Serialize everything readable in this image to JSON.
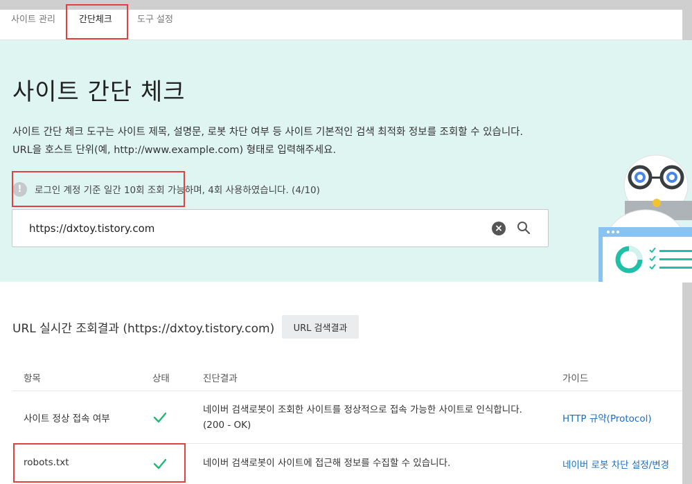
{
  "tabs": [
    "사이트 관리",
    "간단체크",
    "도구 설정"
  ],
  "hero": {
    "title": "사이트 간단 체크",
    "desc_line1": "사이트 간단 체크 도구는 사이트 제목, 설명문, 로봇 차단 여부 등 사이트 기본적인 검색 최적화 정보를 조회할 수 있습니다.",
    "desc_line2": "URL을 호스트 단위(예, http://www.example.com) 형태로 입력해주세요.",
    "notice": "로그인 계정 기준 일간 10회 조회 가능하며, 4회 사용하였습니다. (4/10)"
  },
  "search": {
    "value": "https://dxtoy.tistory.com"
  },
  "results": {
    "title": "URL 실시간 조회결과 (https://dxtoy.tistory.com)",
    "url_button": "URL 검색결과",
    "headers": [
      "항목",
      "상태",
      "진단결과",
      "가이드"
    ],
    "rows": [
      {
        "item": "사이트 정상 접속 여부",
        "diag_line1": "네이버 검색로봇이 조회한 사이트를 정상적으로 접속 가능한 사이트로 인식합니다.",
        "diag_line2": "(200 - OK)",
        "guide": "HTTP 규약(Protocol)"
      },
      {
        "item": "robots.txt",
        "diag_line1": "네이버 검색로봇이 사이트에 접근해 정보를 수집할 수 있습니다.",
        "diag_line2": "",
        "guide": "네이버 로봇 차단 설정/변경"
      }
    ]
  },
  "colors": {
    "hero_bg": "#dff5f1",
    "highlight": "#e2403f",
    "check": "#1fb874",
    "link": "#1b6ec2"
  }
}
